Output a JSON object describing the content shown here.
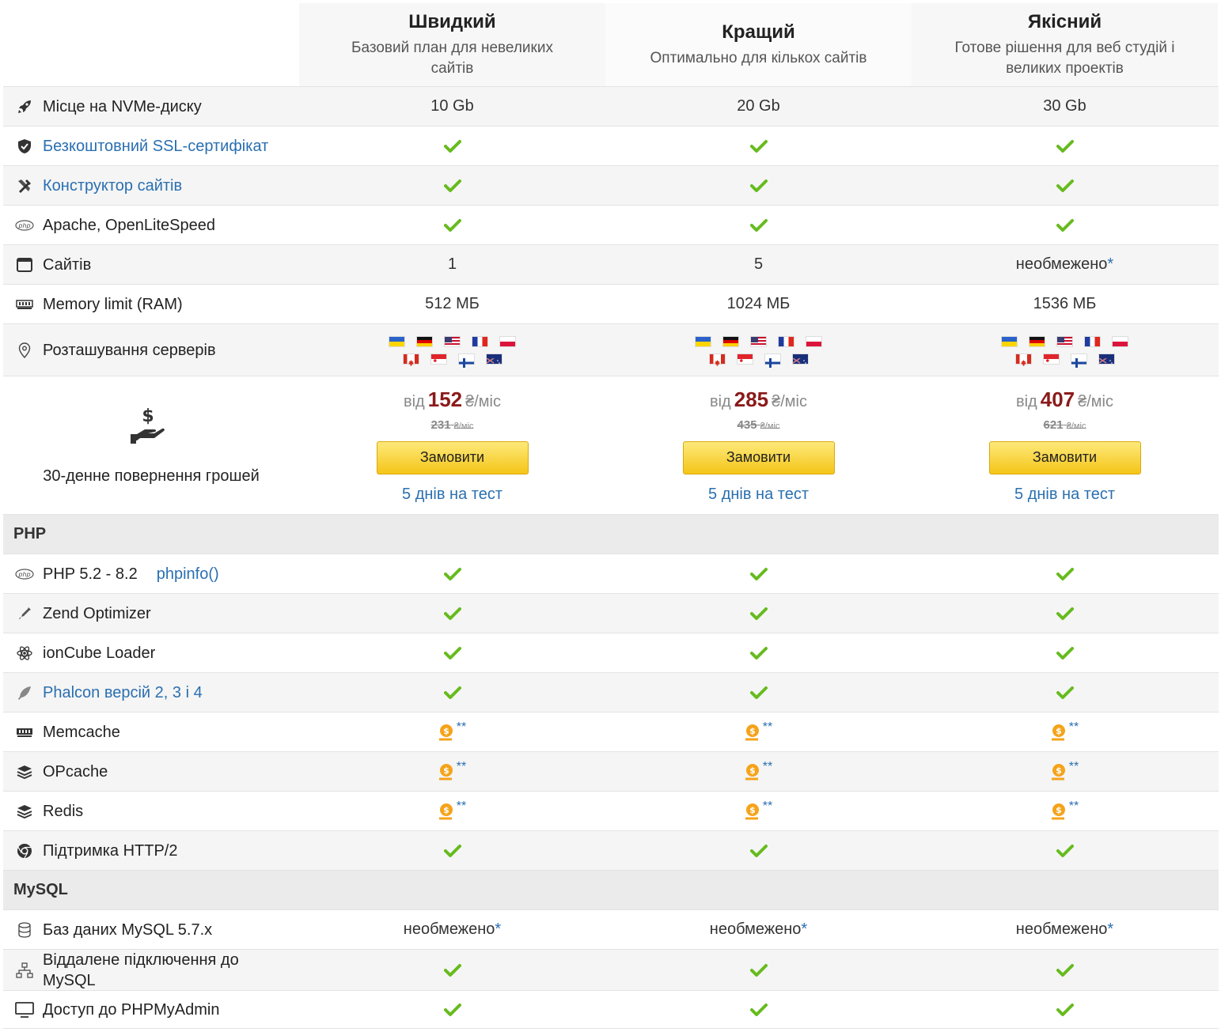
{
  "plans": [
    {
      "name": "Швидкий",
      "desc": "Базовий план для невеликих сайтів",
      "price": "152",
      "old_price": "231",
      "order": "Замовити",
      "trial": "5 днів на тест"
    },
    {
      "name": "Кращий",
      "desc": "Оптимально для кількох сайтів",
      "price": "285",
      "old_price": "435",
      "order": "Замовити",
      "trial": "5 днів на тест"
    },
    {
      "name": "Якісний",
      "desc": "Готове рішення для веб студій і великих проектів",
      "price": "407",
      "old_price": "621",
      "order": "Замовити",
      "trial": "5 днів на тест"
    }
  ],
  "price_labels": {
    "from": "від",
    "per_month": "₴/міс",
    "per_month_small": "₴/міс"
  },
  "money_back": "30-денне повернення грошей",
  "sections": {
    "php": "PHP",
    "mysql": "MySQL"
  },
  "rows": {
    "disk": {
      "label": "Місце на NVMe-диску",
      "icon": "rocket-icon",
      "vals": [
        "10 Gb",
        "20 Gb",
        "30 Gb"
      ]
    },
    "ssl": {
      "label": "Безкоштовний SSL-сертифікат",
      "icon": "shield-icon"
    },
    "builder": {
      "label": "Конструктор сайтів",
      "icon": "tools-icon"
    },
    "apache": {
      "label": "Apache, OpenLiteSpeed",
      "icon": "php-icon"
    },
    "sites": {
      "label": "Сайтів",
      "icon": "browser-icon",
      "vals": [
        "1",
        "5",
        "необмежено"
      ],
      "star": "*"
    },
    "ram": {
      "label": "Memory limit (RAM)",
      "icon": "memory-icon",
      "vals": [
        "512 МБ",
        "1024 МБ",
        "1536 МБ"
      ]
    },
    "locations": {
      "label": "Розташування серверів",
      "icon": "map-pin-icon",
      "flags": [
        "ua",
        "de",
        "us",
        "fr",
        "pl",
        "ca",
        "sg",
        "fi",
        "au"
      ]
    },
    "php_ver": {
      "label": "PHP 5.2 - 8.2",
      "link": "phpinfo()",
      "icon": "php-icon"
    },
    "zend": {
      "label": "Zend Optimizer",
      "icon": "syringe-icon"
    },
    "ioncube": {
      "label": "ionCube Loader",
      "icon": "atom-icon"
    },
    "phalcon": {
      "label": "Phalcon версій 2, 3 і 4",
      "icon": "feather-icon"
    },
    "memcache": {
      "label": "Memcache",
      "icon": "memory-icon",
      "note": "**"
    },
    "opcache": {
      "label": "OPcache",
      "icon": "layers-icon",
      "note": "**"
    },
    "redis": {
      "label": "Redis",
      "icon": "layers-icon",
      "note": "**"
    },
    "http2": {
      "label": "Підтримка HTTP/2",
      "icon": "chrome-icon"
    },
    "mysql_db": {
      "label": "Баз даних MySQL 5.7.x",
      "icon": "database-icon",
      "val": "необмежено",
      "star": "*"
    },
    "remote": {
      "label": "Віддалене підключення до MySQL",
      "icon": "network-icon"
    },
    "pma": {
      "label": "Доступ до PHPMyAdmin",
      "icon": "monitor-icon"
    }
  },
  "colors": {
    "check": "#66bb1e",
    "price": "#8b1a1a",
    "link": "#2a6fb0",
    "coin": "#f5a31a",
    "button": "#f5c518"
  }
}
